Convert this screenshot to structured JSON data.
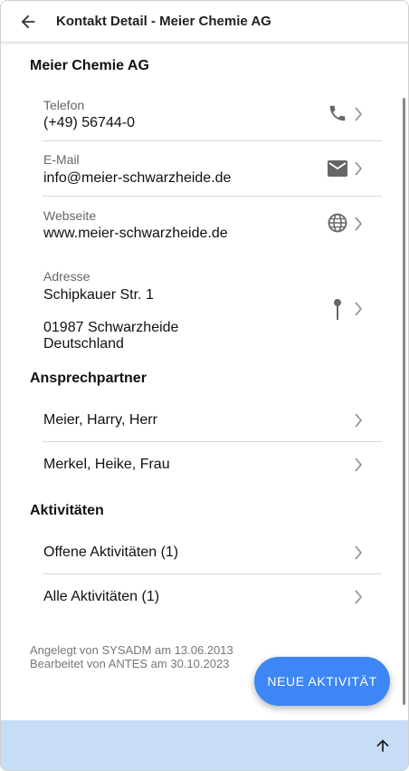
{
  "header": {
    "title": "Kontakt Detail - Meier Chemie AG",
    "back_icon": "arrow-left-icon"
  },
  "company": {
    "name": "Meier Chemie AG",
    "phone": {
      "label": "Telefon",
      "value": "(+49) 56744-0",
      "icon": "phone-icon"
    },
    "email": {
      "label": "E-Mail",
      "value": "info@meier-schwarzheide.de",
      "icon": "mail-icon"
    },
    "website": {
      "label": "Webseite",
      "value": "www.meier-schwarzheide.de",
      "icon": "globe-icon"
    },
    "address": {
      "label": "Adresse",
      "street": "Schipkauer Str. 1",
      "city": "01987 Schwarzheide",
      "country": "Deutschland",
      "icon": "map-pin-icon"
    }
  },
  "contacts": {
    "title": "Ansprechpartner",
    "items": [
      {
        "label": "Meier, Harry, Herr"
      },
      {
        "label": "Merkel, Heike, Frau"
      }
    ]
  },
  "activities": {
    "title": "Aktivitäten",
    "items": [
      {
        "label": "Offene Aktivitäten (1)"
      },
      {
        "label": "Alle Aktivitäten (1)"
      }
    ]
  },
  "meta": {
    "created": "Angelegt von SYSADM am 13.06.2013",
    "edited": "Bearbeitet von ANTES am 30.10.2023"
  },
  "fab": {
    "label": "NEUE AKTIVITÄT"
  },
  "colors": {
    "accent": "#3d86f5",
    "footer": "#c7dcf5",
    "icon": "#666666"
  },
  "footer": {
    "up_icon": "arrow-up-icon"
  }
}
